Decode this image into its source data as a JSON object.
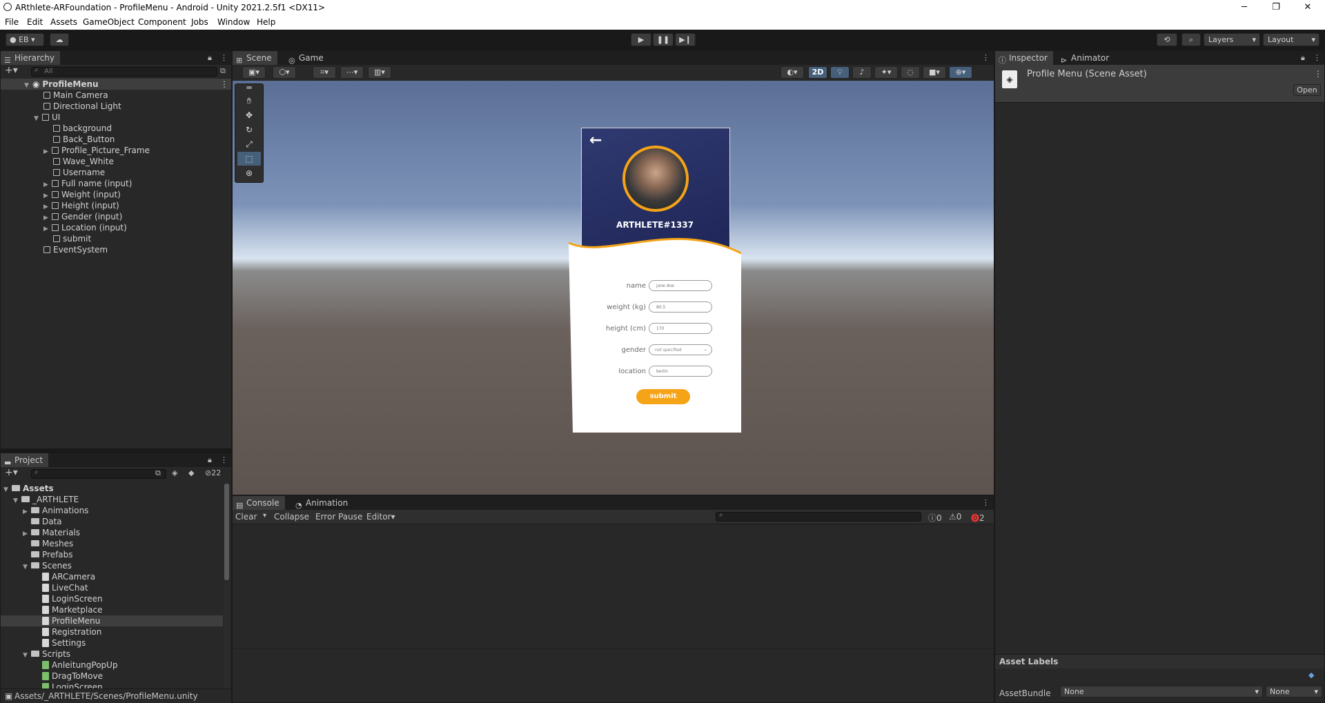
{
  "window": {
    "title": "ARthlete-ARFoundation - ProfileMenu - Android - Unity 2021.2.5f1 <DX11>",
    "controls": [
      "─",
      "❐",
      "✕"
    ]
  },
  "menu": [
    "File",
    "Edit",
    "Assets",
    "GameObject",
    "Component",
    "Jobs",
    "Window",
    "Help"
  ],
  "toolbar": {
    "account": "EB",
    "layers": "Layers",
    "layout": "Layout"
  },
  "hierarchy": {
    "tab": "Hierarchy",
    "search_placeholder": "All",
    "scene": "ProfileMenu",
    "items": [
      {
        "label": "Main Camera"
      },
      {
        "label": "Directional Light"
      },
      {
        "label": "UI"
      },
      {
        "label": "background"
      },
      {
        "label": "Back_Button"
      },
      {
        "label": "Profile_Picture_Frame"
      },
      {
        "label": "Wave_White"
      },
      {
        "label": "Username"
      },
      {
        "label": "Full name (input)"
      },
      {
        "label": "Weight (input)"
      },
      {
        "label": "Height (input)"
      },
      {
        "label": "Gender (input)"
      },
      {
        "label": "Location (input)"
      },
      {
        "label": "submit"
      },
      {
        "label": "EventSystem"
      }
    ]
  },
  "scene_tabs": [
    "Scene",
    "Game"
  ],
  "scene_toolbar": {
    "mode_2d": "2D"
  },
  "profile_card": {
    "username": "ARTHLETE#1337",
    "labels": [
      "name",
      "weight (kg)",
      "height (cm)",
      "gender",
      "location"
    ],
    "placeholders": [
      "jane doe",
      "80,5",
      "170",
      "not specified",
      "berlin"
    ],
    "submit": "submit",
    "colors": {
      "accent": "#f5a317",
      "header": "#2e3565"
    }
  },
  "project": {
    "tab": "Project",
    "hidden_count": "22",
    "root": "Assets",
    "tree": [
      {
        "label": "_ARTHLETE",
        "kind": "folder"
      },
      {
        "label": "Animations",
        "kind": "folder"
      },
      {
        "label": "Data",
        "kind": "folder"
      },
      {
        "label": "Materials",
        "kind": "folder"
      },
      {
        "label": "Meshes",
        "kind": "folder"
      },
      {
        "label": "Prefabs",
        "kind": "folder"
      },
      {
        "label": "Scenes",
        "kind": "folder"
      },
      {
        "label": "ARCamera",
        "kind": "scene"
      },
      {
        "label": "LiveChat",
        "kind": "scene"
      },
      {
        "label": "LoginScreen",
        "kind": "scene"
      },
      {
        "label": "Marketplace",
        "kind": "scene"
      },
      {
        "label": "ProfileMenu",
        "kind": "scene"
      },
      {
        "label": "Registration",
        "kind": "scene"
      },
      {
        "label": "Settings",
        "kind": "scene"
      },
      {
        "label": "Scripts",
        "kind": "folder"
      },
      {
        "label": "AnleitungPopUp",
        "kind": "script"
      },
      {
        "label": "DragToMove",
        "kind": "script"
      },
      {
        "label": "LoginScreen",
        "kind": "script"
      }
    ],
    "path": "Assets/_ARTHLETE/Scenes/ProfileMenu.unity"
  },
  "console": {
    "tabs": [
      "Console",
      "Animation"
    ],
    "clear": "Clear",
    "collapse": "Collapse",
    "error_pause": "Error Pause",
    "editor": "Editor",
    "info_count": "0",
    "warn_count": "0",
    "error_count": "2"
  },
  "inspector": {
    "tabs": [
      "Inspector",
      "Animator"
    ],
    "title": "Profile Menu (Scene Asset)",
    "open": "Open",
    "asset_labels": "Asset Labels",
    "asset_bundle": "AssetBundle",
    "bundle_value": "None",
    "variant_value": "None"
  }
}
